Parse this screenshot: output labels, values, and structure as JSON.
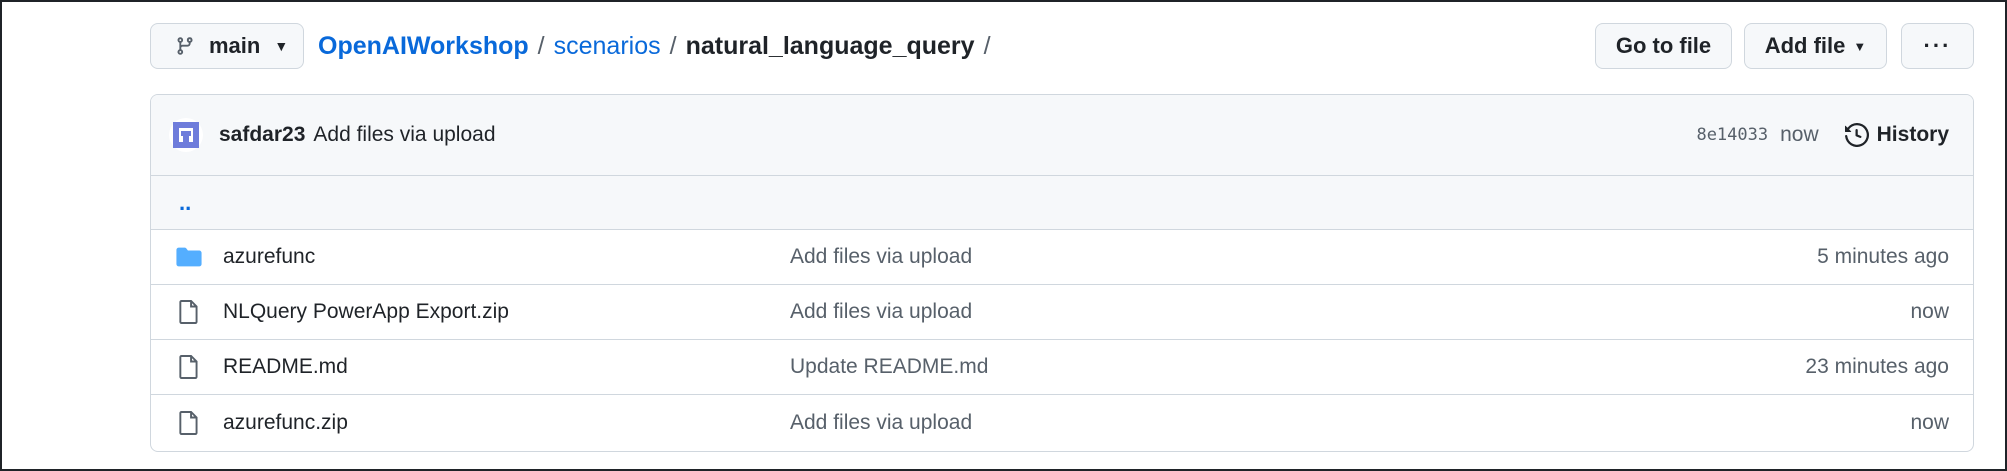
{
  "branch": {
    "name": "main"
  },
  "breadcrumb": {
    "repo": "OpenAIWorkshop",
    "separator": "/",
    "folder": "scenarios",
    "current": "natural_language_query"
  },
  "actions": {
    "go_to_file": "Go to file",
    "add_file": "Add file",
    "more": "···"
  },
  "latest_commit": {
    "user": "safdar23",
    "message": "Add files via upload",
    "sha": "8e14033",
    "time": "now",
    "history_label": "History"
  },
  "parent_link": "..",
  "files": [
    {
      "type": "folder",
      "icon": "folder-icon",
      "name": "azurefunc",
      "message": "Add files via upload",
      "age": "5 minutes ago"
    },
    {
      "type": "file",
      "icon": "file-icon",
      "name": "NLQuery PowerApp Export.zip",
      "message": "Add files via upload",
      "age": "now"
    },
    {
      "type": "file",
      "icon": "file-icon",
      "name": "README.md",
      "message": "Update README.md",
      "age": "23 minutes ago"
    },
    {
      "type": "file",
      "icon": "file-icon",
      "name": "azurefunc.zip",
      "message": "Add files via upload",
      "age": "now"
    }
  ],
  "colors": {
    "link": "#0969da",
    "folder": "#54aeff",
    "muted": "#57606a",
    "border": "#d0d7de",
    "avatar": "#6e7cdb"
  }
}
